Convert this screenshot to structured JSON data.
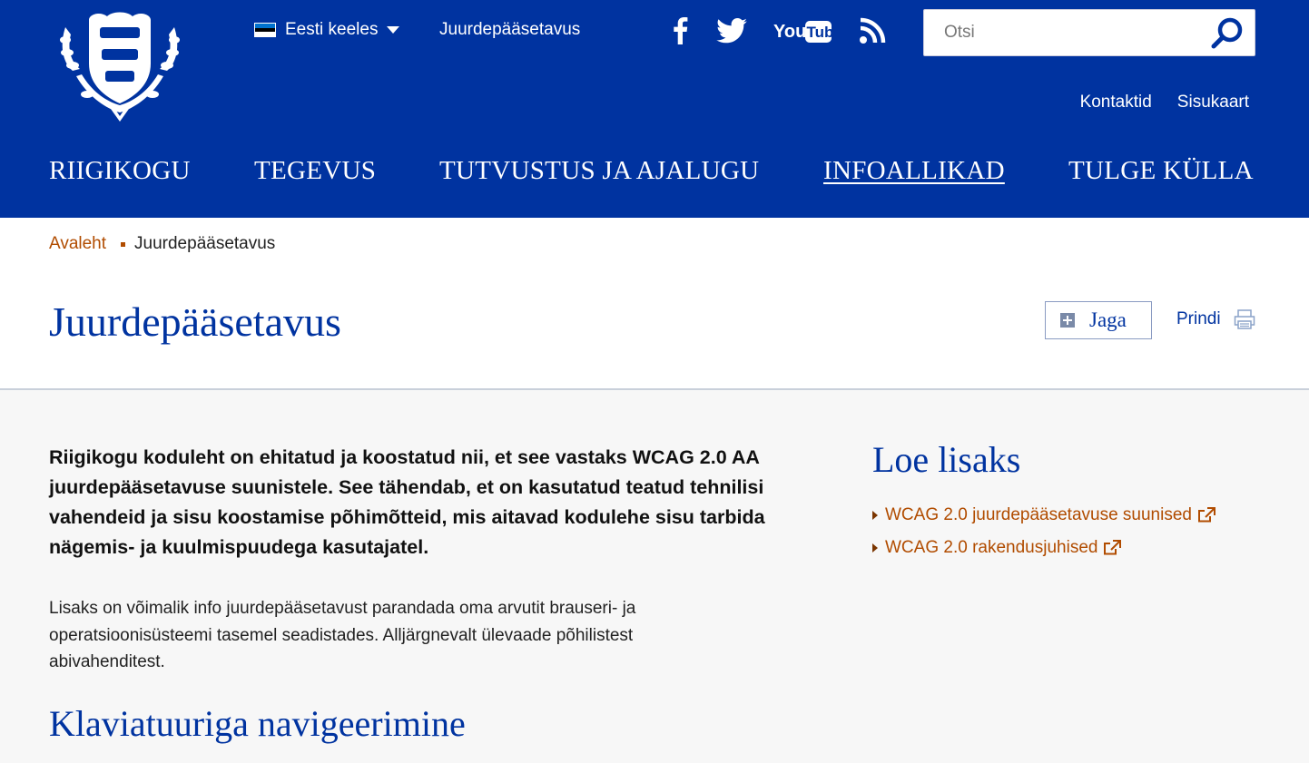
{
  "header": {
    "language": {
      "label": "Eesti keeles",
      "flag_colors": [
        "#0072ce",
        "#000000",
        "#ffffff"
      ]
    },
    "top_link": "Juurdepääsetavus",
    "social": [
      "facebook-icon",
      "twitter-icon",
      "youtube-icon",
      "rss-icon"
    ],
    "search": {
      "placeholder": "Otsi",
      "value": ""
    },
    "utility_links": [
      "Kontaktid",
      "Sisukaart"
    ],
    "nav": [
      {
        "label": "RIIGIKOGU",
        "active": false
      },
      {
        "label": "TEGEVUS",
        "active": false
      },
      {
        "label": "TUTVUSTUS JA AJALUGU",
        "active": false
      },
      {
        "label": "INFOALLIKAD",
        "active": true
      },
      {
        "label": "TULGE KÜLLA",
        "active": false
      }
    ]
  },
  "breadcrumb": {
    "home": "Avaleht",
    "current": "Juurdepääsetavus"
  },
  "page": {
    "title": "Juurdepääsetavus",
    "share_label": "Jaga",
    "print_label": "Prindi",
    "lead": "Riigikogu koduleht on ehitatud ja koostatud nii, et see vastaks WCAG 2.0 AA juurdepääsetavuse suunistele. See tähendab, et on kasutatud teatud tehnilisi vahendeid ja sisu koostamise põhimõtteid, mis aitavad kodulehe sisu tarbida nägemis- ja kuulmispuudega kasutajatel.",
    "body": "Lisaks on võimalik info juurdepääsetavust parandada oma arvutit brauseri- ja operatsioonisüsteemi tasemel seadistades. Alljärgnevalt ülevaade põhilistest abivahenditest.",
    "section_heading": "Klaviatuuriga navigeerimine"
  },
  "aside": {
    "heading": "Loe lisaks",
    "links": [
      "WCAG 2.0 juurdepääsetavuse suunised",
      "WCAG 2.0 rakendusjuhised"
    ]
  },
  "colors": {
    "brand_blue": "#0033a0",
    "link_orange": "#b14c00",
    "page_bg": "#f7f7f7"
  }
}
